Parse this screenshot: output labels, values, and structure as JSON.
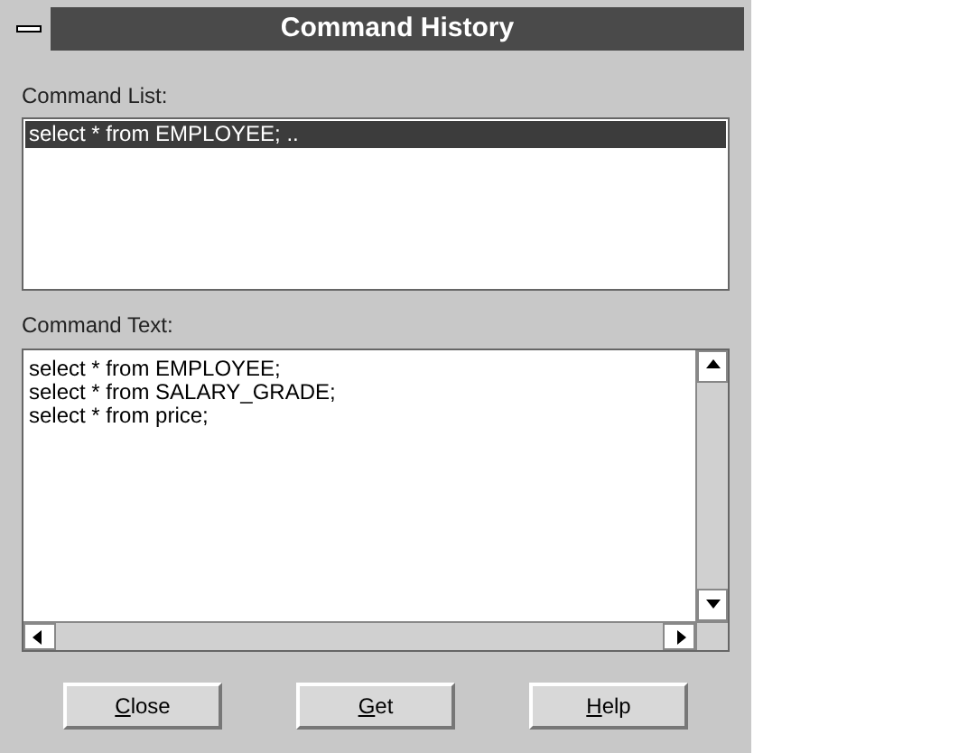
{
  "window": {
    "title": "Command History"
  },
  "command_list": {
    "label": "Command List:",
    "items": [
      {
        "text": "select * from EMPLOYEE; ..",
        "selected": true
      }
    ]
  },
  "command_text": {
    "label": "Command Text:",
    "lines": [
      "select * from EMPLOYEE;",
      "select * from SALARY_GRADE;",
      "select * from price;"
    ]
  },
  "buttons": [
    {
      "mnemonic": "C",
      "rest": "lose"
    },
    {
      "mnemonic": "G",
      "rest": "et"
    },
    {
      "mnemonic": "H",
      "rest": "elp"
    }
  ]
}
